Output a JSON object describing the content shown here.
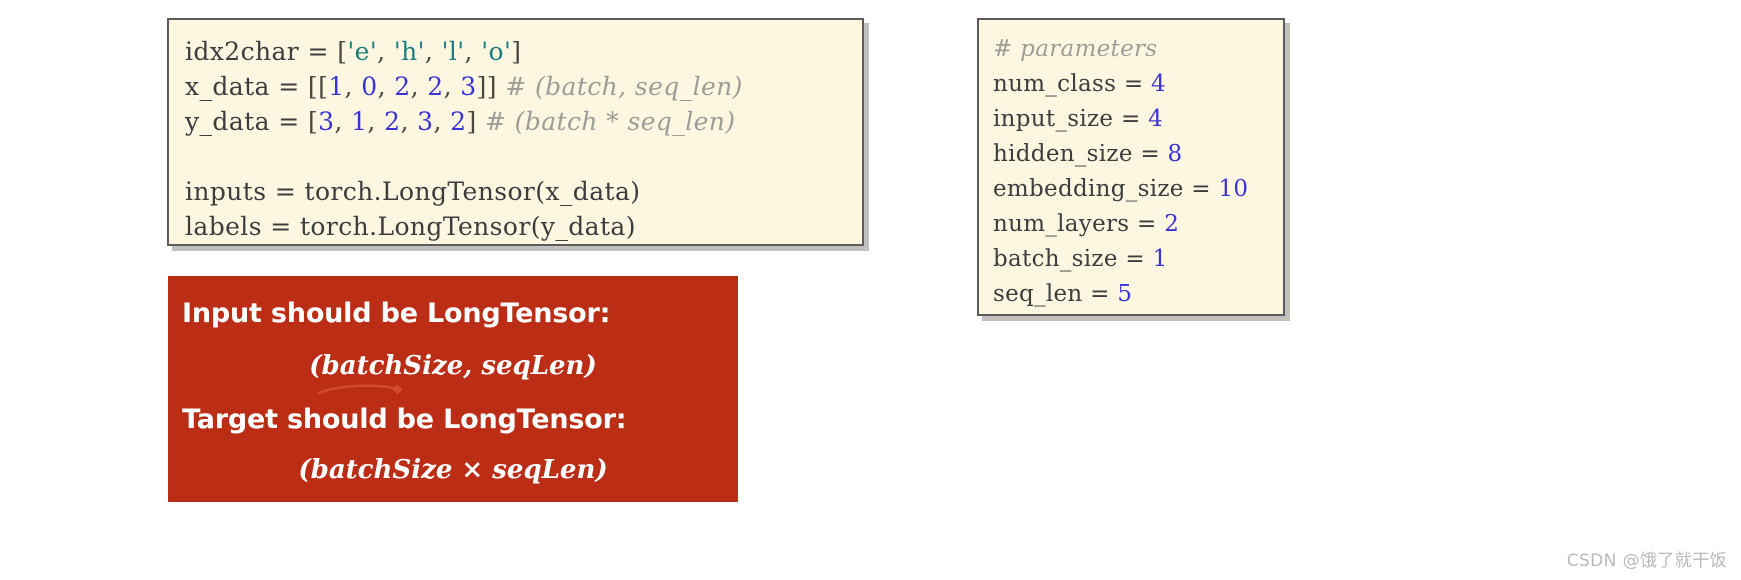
{
  "slide": {
    "background_color": "#ffffff",
    "code_bg_color": "#fdf7e2",
    "code_border_color": "#5b5b5b",
    "callout_color": "#bb2d15",
    "number_color": "#3a34d6",
    "string_color": "#1b7d7d",
    "comment_color": "#9d9d96",
    "ink_color": "#d24a2c"
  },
  "code_left": {
    "lines": [
      {
        "id": "idx2char",
        "tokens": [
          {
            "t": "idx2char ",
            "k": "name"
          },
          {
            "t": "= ",
            "k": "op"
          },
          {
            "t": "[",
            "k": "punct"
          },
          {
            "t": "'e'",
            "k": "str"
          },
          {
            "t": ", ",
            "k": "punct"
          },
          {
            "t": "'h'",
            "k": "str"
          },
          {
            "t": ", ",
            "k": "punct"
          },
          {
            "t": "'l'",
            "k": "str"
          },
          {
            "t": ", ",
            "k": "punct"
          },
          {
            "t": "'o'",
            "k": "str"
          },
          {
            "t": "]",
            "k": "punct"
          }
        ]
      },
      {
        "id": "x_data",
        "tokens": [
          {
            "t": "x_data ",
            "k": "name"
          },
          {
            "t": "= ",
            "k": "op"
          },
          {
            "t": "[[",
            "k": "punct"
          },
          {
            "t": "1",
            "k": "num"
          },
          {
            "t": ", ",
            "k": "punct"
          },
          {
            "t": "0",
            "k": "num"
          },
          {
            "t": ", ",
            "k": "punct"
          },
          {
            "t": "2",
            "k": "num"
          },
          {
            "t": ", ",
            "k": "punct"
          },
          {
            "t": "2",
            "k": "num"
          },
          {
            "t": ", ",
            "k": "punct"
          },
          {
            "t": "3",
            "k": "num"
          },
          {
            "t": "]] ",
            "k": "punct"
          },
          {
            "t": "# (batch, seq_len)",
            "k": "comment"
          }
        ]
      },
      {
        "id": "y_data",
        "tokens": [
          {
            "t": "y_data ",
            "k": "name"
          },
          {
            "t": "= ",
            "k": "op"
          },
          {
            "t": "[",
            "k": "punct"
          },
          {
            "t": "3",
            "k": "num"
          },
          {
            "t": ", ",
            "k": "punct"
          },
          {
            "t": "1",
            "k": "num"
          },
          {
            "t": ", ",
            "k": "punct"
          },
          {
            "t": "2",
            "k": "num"
          },
          {
            "t": ", ",
            "k": "punct"
          },
          {
            "t": "3",
            "k": "num"
          },
          {
            "t": ", ",
            "k": "punct"
          },
          {
            "t": "2",
            "k": "num"
          },
          {
            "t": "] ",
            "k": "punct"
          },
          {
            "t": "# (batch * seq_len)",
            "k": "comment"
          }
        ]
      },
      {
        "id": "blank",
        "tokens": [
          {
            "t": " ",
            "k": "name"
          }
        ]
      },
      {
        "id": "inputs",
        "tokens": [
          {
            "t": "inputs ",
            "k": "name"
          },
          {
            "t": "= ",
            "k": "op"
          },
          {
            "t": "torch.LongTensor(x_data)",
            "k": "name"
          }
        ]
      },
      {
        "id": "labels",
        "tokens": [
          {
            "t": "labels ",
            "k": "name"
          },
          {
            "t": "= ",
            "k": "op"
          },
          {
            "t": "torch.LongTensor(y_data)",
            "k": "name"
          }
        ]
      }
    ],
    "plain_text": "idx2char = ['e', 'h', 'l', 'o']\nx_data = [[1, 0, 2, 2, 3]] # (batch, seq_len)\ny_data = [3, 1, 2, 3, 2] # (batch * seq_len)\n\ninputs = torch.LongTensor(x_data)\nlabels = torch.LongTensor(y_data)"
  },
  "code_params": {
    "lines": [
      {
        "id": "comment-parameters",
        "tokens": [
          {
            "t": "# parameters",
            "k": "comment"
          }
        ]
      },
      {
        "id": "num_class",
        "tokens": [
          {
            "t": "num_class ",
            "k": "name"
          },
          {
            "t": "= ",
            "k": "op"
          },
          {
            "t": "4",
            "k": "num"
          }
        ]
      },
      {
        "id": "input_size",
        "tokens": [
          {
            "t": "input_size ",
            "k": "name"
          },
          {
            "t": "= ",
            "k": "op"
          },
          {
            "t": "4",
            "k": "num"
          }
        ]
      },
      {
        "id": "hidden_size",
        "tokens": [
          {
            "t": "hidden_size ",
            "k": "name"
          },
          {
            "t": "= ",
            "k": "op"
          },
          {
            "t": "8",
            "k": "num"
          }
        ]
      },
      {
        "id": "embedding_size",
        "tokens": [
          {
            "t": "embedding_size ",
            "k": "name"
          },
          {
            "t": "= ",
            "k": "op"
          },
          {
            "t": "10",
            "k": "num"
          }
        ]
      },
      {
        "id": "num_layers",
        "tokens": [
          {
            "t": "num_layers ",
            "k": "name"
          },
          {
            "t": "= ",
            "k": "op"
          },
          {
            "t": "2",
            "k": "num"
          }
        ]
      },
      {
        "id": "batch_size",
        "tokens": [
          {
            "t": "batch_size ",
            "k": "name"
          },
          {
            "t": "= ",
            "k": "op"
          },
          {
            "t": "1",
            "k": "num"
          }
        ]
      },
      {
        "id": "seq_len",
        "tokens": [
          {
            "t": "seq_len ",
            "k": "name"
          },
          {
            "t": "= ",
            "k": "op"
          },
          {
            "t": "5",
            "k": "num"
          }
        ]
      }
    ],
    "plain_text": "# parameters\nnum_class = 4\ninput_size = 4\nhidden_size = 8\nembedding_size = 10\nnum_layers = 2\nbatch_size = 1\nseq_len = 5"
  },
  "callout": {
    "input_heading": "Input should be LongTensor:",
    "input_formula": "(batchSize, seqLen)",
    "target_heading": "Target should be LongTensor:",
    "target_formula": "(batchSize × seqLen)"
  },
  "watermark": {
    "text": "CSDN @饿了就干饭"
  }
}
